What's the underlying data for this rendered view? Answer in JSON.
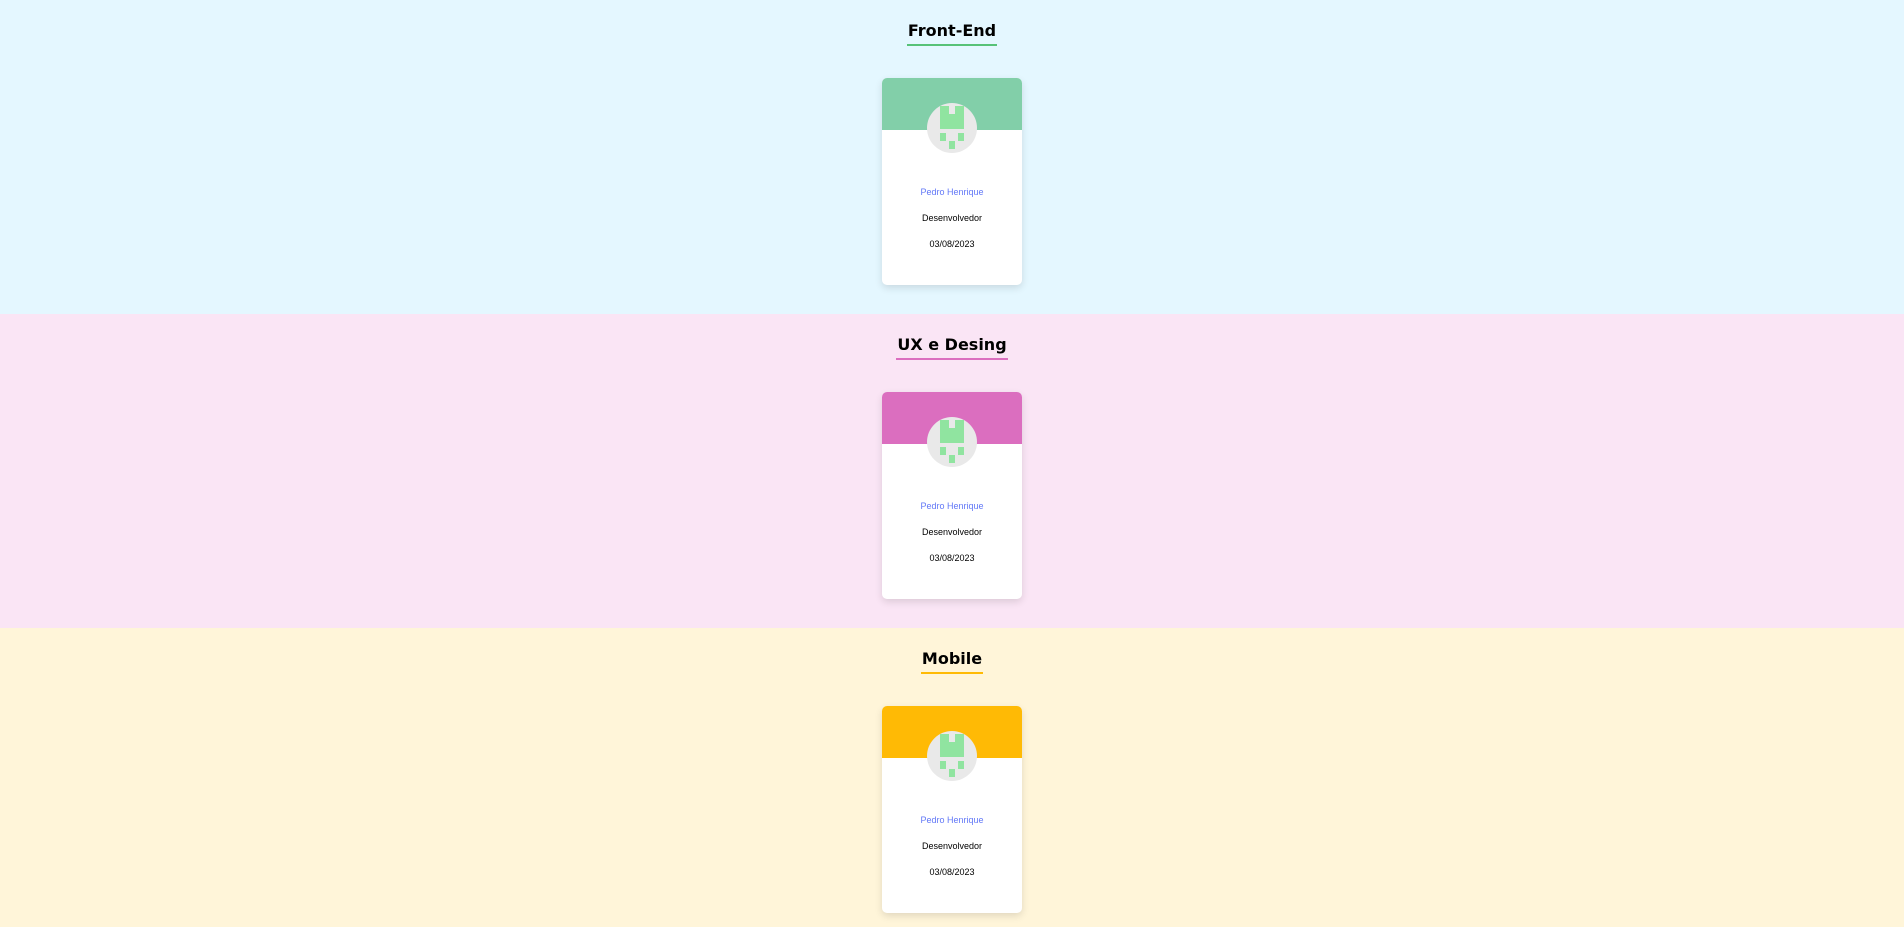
{
  "sections": [
    {
      "title": "Front-End",
      "background": "#e4f7ff",
      "accent": "#82cfa9",
      "title_underline": "#57c278",
      "card": {
        "name": "Pedro Henrique",
        "role": "Desenvolvedor",
        "date": "03/08/2023",
        "avatar_icon": "broken-image-icon"
      }
    },
    {
      "title": "UX e Desing",
      "background": "#fae5f5",
      "accent": "#db6ebf",
      "title_underline": "#db6ebf",
      "card": {
        "name": "Pedro Henrique",
        "role": "Desenvolvedor",
        "date": "03/08/2023",
        "avatar_icon": "broken-image-icon"
      }
    },
    {
      "title": "Mobile",
      "background": "#fff5d9",
      "accent": "#ffba05",
      "title_underline": "#ffba05",
      "card": {
        "name": "Pedro Henrique",
        "role": "Desenvolvedor",
        "date": "03/08/2023",
        "avatar_icon": "broken-image-icon"
      }
    }
  ],
  "colors": {
    "name_text": "#6278f7",
    "avatar_placeholder": "#90e4a0"
  }
}
